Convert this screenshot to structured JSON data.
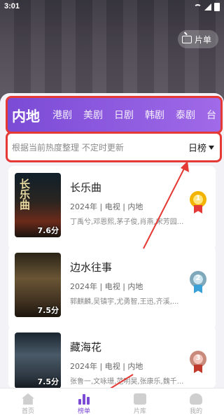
{
  "status_bar": {
    "time": "3:01"
  },
  "header": {
    "piandan_label": "片单"
  },
  "tabs": [
    {
      "label": "内地",
      "active": true
    },
    {
      "label": "港剧"
    },
    {
      "label": "美剧"
    },
    {
      "label": "日剧"
    },
    {
      "label": "韩剧"
    },
    {
      "label": "泰剧"
    },
    {
      "label": "台"
    }
  ],
  "filter": {
    "hint": "根据当前热度整理 不定时更新",
    "selected": "日榜"
  },
  "items": [
    {
      "rank": "1",
      "title": "长乐曲",
      "meta": "2024年 | 电视 | 内地",
      "cast": "丁禹兮,邓恩熙,茅子俊,肖燕,宋芳园...",
      "score": "7.6分",
      "poster_title": "长乐曲"
    },
    {
      "rank": "2",
      "title": "边水往事",
      "meta": "2024年 | 电视 | 内地",
      "cast": "郭麒麟,吴镇宇,尤勇智,王迅,齐溪,...",
      "score": "7.5分",
      "poster_title": ""
    },
    {
      "rank": "3",
      "title": "藏海花",
      "meta": "2024年 | 电视 | 内地",
      "cast": "张鲁一,文咏珊,范明昊,张康乐,魏千...",
      "score": "7.5分",
      "poster_title": ""
    }
  ],
  "bottom_nav": [
    {
      "label": "首页",
      "icon": "home-icon"
    },
    {
      "label": "榜单",
      "icon": "chart-icon",
      "active": true
    },
    {
      "label": "片库",
      "icon": "library-icon"
    },
    {
      "label": "我的",
      "icon": "user-icon"
    }
  ],
  "colors": {
    "accent": "#7b4bd6",
    "highlight": "#e53935"
  }
}
